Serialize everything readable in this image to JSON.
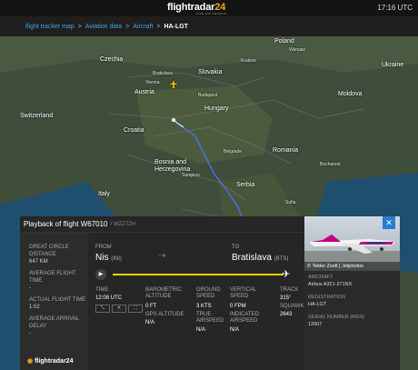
{
  "header": {
    "logo_main": "flightradar",
    "logo_num": "24",
    "logo_sub": "LIVE AIR TRAFFIC",
    "clock": "17:16 UTC"
  },
  "breadcrumb": {
    "items": [
      "flight tracker map",
      "Aviation data",
      "Aircraft"
    ],
    "separator": ">",
    "current": "HA-LGT"
  },
  "map": {
    "countries": [
      "Poland",
      "Czechia",
      "Slovakia",
      "Austria",
      "Hungary",
      "Switzerland",
      "Croatia",
      "Bosnia and Herzegovina",
      "Serbia",
      "Moldova",
      "Ukraine",
      "Romania",
      "Italy"
    ],
    "cities": [
      "Warsaw",
      "Kraków",
      "Vienna",
      "Budapest",
      "Bratislava",
      "Belgrade",
      "Sofia",
      "Bucharest",
      "Sarajevo"
    ],
    "route_color": "#4a6ff0",
    "route_start_color": "#9fd8ff"
  },
  "playback": {
    "title": "Playback of flight W67010",
    "callsign": "/ WZZ7ZH",
    "great_circle_label": "GREAT CIRCLE DISTANCE",
    "great_circle_value": "647 KM",
    "avg_flight_label": "AVERAGE FLIGHT TIME",
    "avg_flight_value": "-",
    "actual_flight_label": "ACTUAL FLIGHT TIME",
    "actual_flight_value": "1:02",
    "avg_delay_label": "AVERAGE ARRIVAL DELAY",
    "avg_delay_value": "-",
    "from_label": "FROM",
    "from_city": "Nis",
    "from_code": "(INI)",
    "to_label": "TO",
    "to_city": "Bratislava",
    "to_code": "(BTS)",
    "time_label": "TIME",
    "time_value": "12:08 UTC",
    "baro_label": "BAROMETRIC ALTITUDE",
    "baro_value": "0 FT",
    "gps_label": "GPS ALTITUDE",
    "gps_value": "N/A",
    "gs_label": "GROUND SPEED",
    "gs_value": "3 KTS",
    "tas_label": "TRUE AIRSPEED",
    "tas_value": "N/A",
    "vs_label": "VERTICAL SPEED",
    "vs_value": "0 FPM",
    "ias_label": "INDICATED AIRSPEED",
    "ias_value": "N/A",
    "track_label": "TRACK",
    "track_value": "315°",
    "squawk_label": "SQUAWK",
    "squawk_value": "2643",
    "play_icon": "play-icon",
    "progress_color": "#f0d000",
    "controls": [
      "⤡",
      "✕",
      "⛶"
    ],
    "footer_logo": "flightradar24"
  },
  "aircraft": {
    "credit": "© Tekler Zsolt | Jetphotos",
    "type_label": "AIRCRAFT",
    "type_value": "Airbus A321-271NX",
    "reg_label": "REGISTRATION",
    "reg_value": "HA-LGT",
    "serial_label": "SERIAL NUMBER (MSN)",
    "serial_value": "12607",
    "close_label": "✕"
  }
}
